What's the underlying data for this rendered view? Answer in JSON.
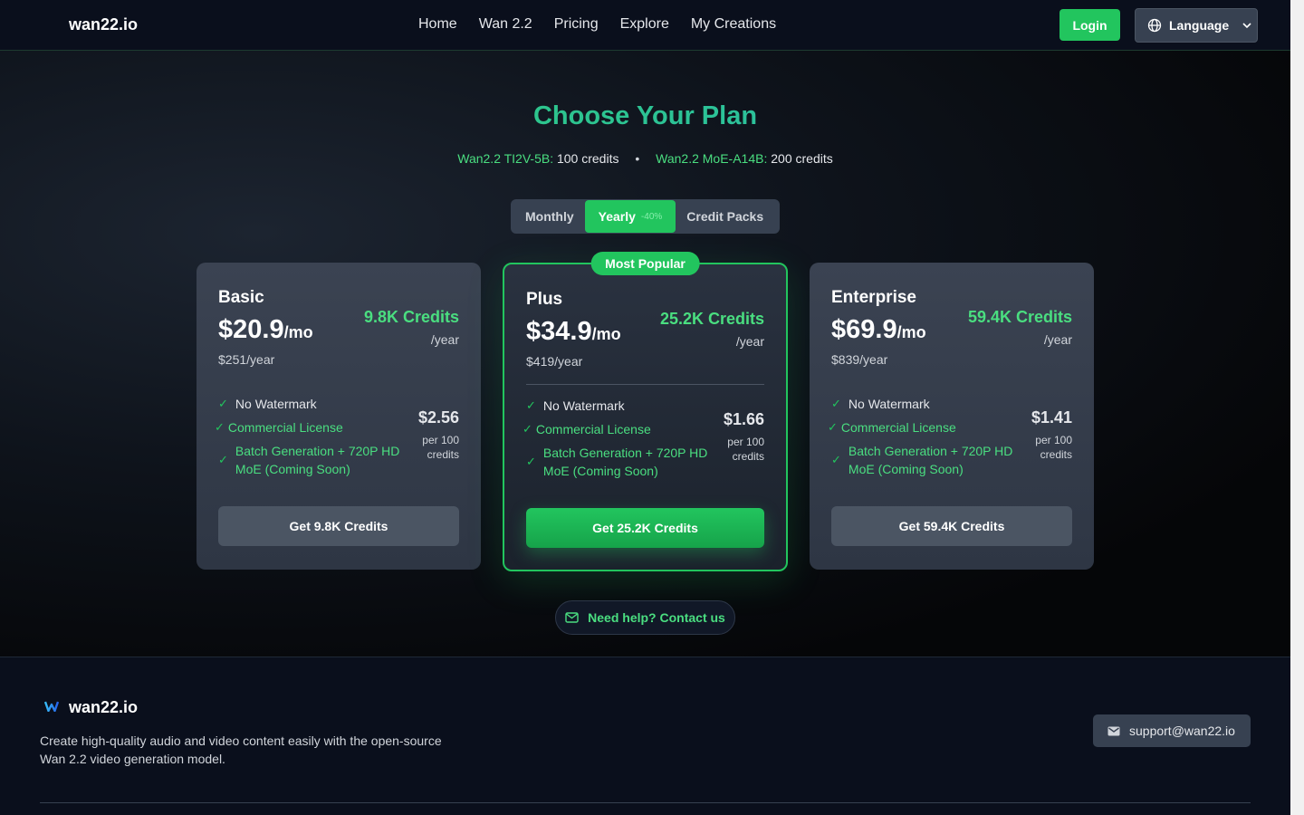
{
  "header": {
    "logo": "wan22.io",
    "nav": [
      "Home",
      "Wan 2.2",
      "Pricing",
      "Explore",
      "My Creations"
    ],
    "login": "Login",
    "language": "Language"
  },
  "hero": {
    "title": "Choose Your Plan",
    "model1_name": "Wan2.2 TI2V-5B:",
    "model1_credits": "100 credits",
    "separator": "•",
    "model2_name": "Wan2.2 MoE-A14B:",
    "model2_credits": "200 credits"
  },
  "billing_toggle": {
    "monthly": "Monthly",
    "yearly": "Yearly",
    "yearly_save": "-40%",
    "credit_packs": "Credit Packs",
    "selected": "Yearly"
  },
  "plans": [
    {
      "name": "Basic",
      "price": "$20.9",
      "per": "/mo",
      "yearly": "$251/year",
      "credits": "9.8K Credits",
      "credits_period": "/year",
      "features": [
        "No Watermark",
        "Commercial License",
        "Batch Generation + 720P HD MoE (Coming Soon)"
      ],
      "unit_price": "$2.56",
      "unit_label": "per 100 credits",
      "cta": "Get 9.8K Credits",
      "badge": ""
    },
    {
      "name": "Plus",
      "price": "$34.9",
      "per": "/mo",
      "yearly": "$419/year",
      "credits": "25.2K Credits",
      "credits_period": "/year",
      "features": [
        "No Watermark",
        "Commercial License",
        "Batch Generation + 720P HD MoE (Coming Soon)"
      ],
      "unit_price": "$1.66",
      "unit_label": "per 100 credits",
      "cta": "Get 25.2K Credits",
      "badge": "Most Popular"
    },
    {
      "name": "Enterprise",
      "price": "$69.9",
      "per": "/mo",
      "yearly": "$839/year",
      "credits": "59.4K Credits",
      "credits_period": "/year",
      "features": [
        "No Watermark",
        "Commercial License",
        "Batch Generation + 720P HD MoE (Coming Soon)"
      ],
      "unit_price": "$1.41",
      "unit_label": "per 100 credits",
      "cta": "Get 59.4K Credits",
      "badge": ""
    }
  ],
  "help": {
    "label": "Need help? Contact us",
    "icon": "mail-icon"
  },
  "footer": {
    "name": "wan22.io",
    "description": "Create high-quality audio and video content easily with the open-source Wan 2.2 video generation model.",
    "email": "support@wan22.io"
  },
  "colors": {
    "accent": "#22c55e",
    "accent_text": "#4ade80",
    "background": "#06080d",
    "card": "#3b4352"
  }
}
